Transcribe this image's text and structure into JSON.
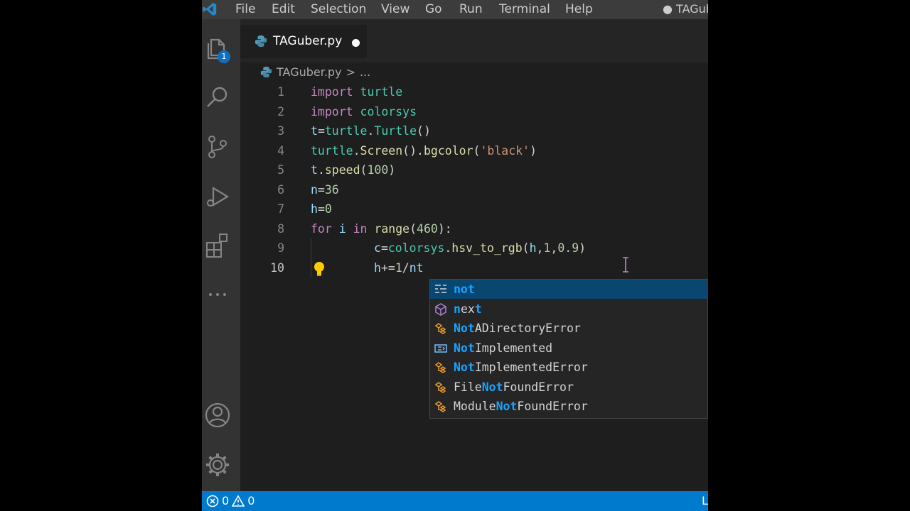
{
  "menubar": {
    "items": [
      "File",
      "Edit",
      "Selection",
      "View",
      "Go",
      "Run",
      "Terminal",
      "Help"
    ],
    "title": "● TAGub"
  },
  "activitybar": {
    "explorer_badge": "1",
    "icons": [
      "files-icon",
      "search-icon",
      "source-control-icon",
      "run-debug-icon",
      "extensions-icon",
      "more-icon",
      "account-icon",
      "settings-gear-icon"
    ]
  },
  "tab": {
    "label": "TAGuber.py"
  },
  "breadcrumb": {
    "file": "TAGuber.py",
    "separator": ">",
    "more": "..."
  },
  "editor": {
    "lines": [
      {
        "n": "1",
        "tokens": [
          [
            "import",
            "kw"
          ],
          [
            " ",
            "txt"
          ],
          [
            "turtle",
            "mod"
          ]
        ]
      },
      {
        "n": "2",
        "tokens": [
          [
            "import",
            "kw"
          ],
          [
            " ",
            "txt"
          ],
          [
            "colorsys",
            "mod"
          ]
        ]
      },
      {
        "n": "3",
        "tokens": [
          [
            "t",
            "id"
          ],
          [
            "=",
            "txt"
          ],
          [
            "turtle",
            "mod"
          ],
          [
            ".",
            "txt"
          ],
          [
            "Turtle",
            "mod"
          ],
          [
            "()",
            "txt"
          ]
        ]
      },
      {
        "n": "4",
        "tokens": [
          [
            "turtle",
            "mod"
          ],
          [
            ".",
            "txt"
          ],
          [
            "Screen",
            "fn"
          ],
          [
            "().",
            "txt"
          ],
          [
            "bgcolor",
            "fn"
          ],
          [
            "(",
            "txt"
          ],
          [
            "'black'",
            "str"
          ],
          [
            ")",
            "txt"
          ]
        ]
      },
      {
        "n": "5",
        "tokens": [
          [
            "t",
            "id"
          ],
          [
            ".",
            "txt"
          ],
          [
            "speed",
            "fn"
          ],
          [
            "(",
            "txt"
          ],
          [
            "100",
            "num"
          ],
          [
            ")",
            "txt"
          ]
        ]
      },
      {
        "n": "6",
        "tokens": [
          [
            "n",
            "id"
          ],
          [
            "=",
            "txt"
          ],
          [
            "36",
            "num"
          ]
        ]
      },
      {
        "n": "7",
        "tokens": [
          [
            "h",
            "id"
          ],
          [
            "=",
            "txt"
          ],
          [
            "0",
            "num"
          ]
        ]
      },
      {
        "n": "8",
        "tokens": [
          [
            "for",
            "kw"
          ],
          [
            " ",
            "txt"
          ],
          [
            "i",
            "id"
          ],
          [
            " ",
            "txt"
          ],
          [
            "in",
            "kw"
          ],
          [
            " ",
            "txt"
          ],
          [
            "range",
            "fn"
          ],
          [
            "(",
            "txt"
          ],
          [
            "460",
            "num"
          ],
          [
            "):",
            "txt"
          ]
        ]
      },
      {
        "n": "9",
        "indent": true,
        "tokens": [
          [
            "c",
            "id"
          ],
          [
            "=",
            "txt"
          ],
          [
            "colorsys",
            "mod"
          ],
          [
            ".",
            "txt"
          ],
          [
            "hsv_to_rgb",
            "fn"
          ],
          [
            "(",
            "txt"
          ],
          [
            "h",
            "id"
          ],
          [
            ",",
            "txt"
          ],
          [
            "1",
            "num"
          ],
          [
            ",",
            "txt"
          ],
          [
            "0.9",
            "num"
          ],
          [
            ")",
            "txt"
          ]
        ]
      },
      {
        "n": "10",
        "indent": true,
        "active": true,
        "tokens": [
          [
            "h",
            "id"
          ],
          [
            "+=",
            "txt"
          ],
          [
            "1",
            "num"
          ],
          [
            "/",
            "txt"
          ],
          [
            "nt",
            "id"
          ]
        ]
      }
    ]
  },
  "suggestions": [
    {
      "icon": "keyword-icon",
      "parts": [
        [
          "not",
          true
        ]
      ],
      "selected": true
    },
    {
      "icon": "module-icon",
      "parts": [
        [
          "n",
          true
        ],
        [
          "ex",
          false
        ],
        [
          "t",
          true
        ]
      ]
    },
    {
      "icon": "class-icon",
      "parts": [
        [
          "Not",
          true
        ],
        [
          "ADirectoryError",
          false
        ]
      ]
    },
    {
      "icon": "enum-icon",
      "parts": [
        [
          "Not",
          true
        ],
        [
          "Implemented",
          false
        ]
      ]
    },
    {
      "icon": "class-icon",
      "parts": [
        [
          "Not",
          true
        ],
        [
          "ImplementedError",
          false
        ]
      ]
    },
    {
      "icon": "class-icon",
      "parts": [
        [
          "File",
          false
        ],
        [
          "Not",
          true
        ],
        [
          "FoundError",
          false
        ]
      ]
    },
    {
      "icon": "class-icon",
      "parts": [
        [
          "Module",
          false
        ],
        [
          "Not",
          true
        ],
        [
          "FoundError",
          false
        ]
      ]
    }
  ],
  "statusbar": {
    "errors": "0",
    "warnings": "0",
    "right_text": "L"
  },
  "colors": {
    "accent": "#007acc",
    "selection": "#094771",
    "match": "#18a3ff"
  }
}
